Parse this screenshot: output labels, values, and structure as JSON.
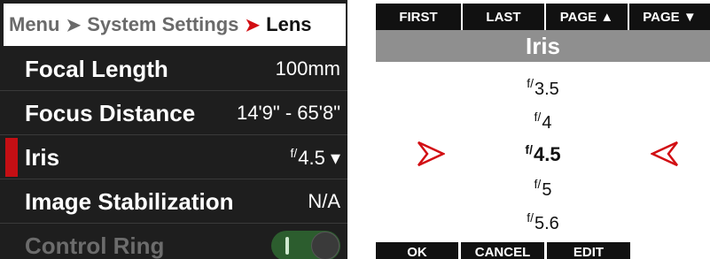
{
  "left": {
    "breadcrumb": {
      "menu": "Menu",
      "sep": "➤",
      "section": "System Settings",
      "current": "Lens"
    },
    "rows": [
      {
        "label": "Focal Length",
        "value": "100mm"
      },
      {
        "label": "Focus Distance",
        "value": "14'9\" - 65'8\""
      },
      {
        "label": "Iris",
        "value_prefix": "f/",
        "value": "4.5",
        "dropdown": "▾"
      },
      {
        "label": "Image Stabilization",
        "value": "N/A"
      },
      {
        "label": "Control Ring",
        "toggle_state": "on"
      }
    ]
  },
  "right": {
    "nav": {
      "first": "FIRST",
      "last": "LAST",
      "page_up": "PAGE ▲",
      "page_down": "PAGE ▼"
    },
    "title": "Iris",
    "f_prefix": "f/",
    "options": [
      "3.5",
      "4",
      "4.5",
      "5",
      "5.6"
    ],
    "selected": "4.5",
    "buttons": {
      "ok": "OK",
      "cancel": "CANCEL",
      "edit": "EDIT"
    },
    "colors": {
      "accent": "#d20e13"
    }
  }
}
